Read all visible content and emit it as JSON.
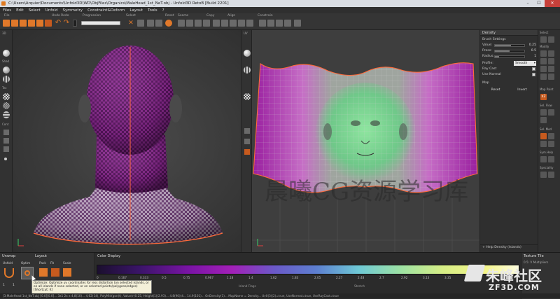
{
  "window": {
    "title": "C:\\Users\\Arquier\\Documents\\Unfold3D\\WD\\ObjFiles\\Organics\\MaleHead_1st_NeT.obj - Unfold3D RetoB [Build 2201]",
    "controls": [
      "–",
      "☐",
      "✕"
    ]
  },
  "menu": [
    "Files",
    "Edit",
    "Select",
    "Unfold",
    "Symmetry",
    "Constraint&Deform",
    "Layout",
    "Tools",
    "?"
  ],
  "toolbar": {
    "groups": [
      "File",
      "Undo Redo",
      "Progression",
      "Select",
      "Reset",
      "Seams",
      "Copy",
      "Align",
      "Constrain"
    ]
  },
  "left_strip": {
    "labels": [
      "3D",
      "Shad",
      "Tex",
      "Cont"
    ]
  },
  "uv_view": {
    "label": "UV"
  },
  "density_panel": {
    "header": "Density",
    "section": "Brush Settings",
    "rows": [
      {
        "label": "Value:",
        "value": "0.25",
        "fill": 0.55
      },
      {
        "label": "Press:",
        "value": "0.5",
        "fill": 0.5
      },
      {
        "label": "Radius:",
        "value": "1",
        "fill": 0.15
      }
    ],
    "profile_label": "Profile:",
    "profile_value": "Smooth",
    "ray_cast": "Ray Cast",
    "use_normal": "Use Normal",
    "map_label": "Map",
    "reset": "Reset",
    "invert": "Invert",
    "help": "Help Density (Islands)"
  },
  "right_strip": {
    "labels": [
      "Select",
      "Modify",
      "Map Paint",
      "Sel. Flow",
      "Sel. Mod",
      "Sym.Help",
      "Speciality"
    ]
  },
  "unwrap_panel": {
    "header_unwrap": "Unwrap",
    "header_layout": "Layout",
    "tabs": [
      "Unfold",
      "Optim",
      "Pack",
      "Fit",
      "Scale"
    ],
    "num_left": "1",
    "num_right": "1"
  },
  "color_display": {
    "header": "Color Display",
    "ticks": [
      "0",
      "0.167",
      "0.333",
      "0.5",
      "0.75",
      "0.967",
      "1.18",
      "1.4",
      "1.62",
      "1.83",
      "2.05",
      "2.27",
      "2.48",
      "2.7",
      "2.92",
      "3.13",
      "3.35",
      "3.57",
      "3.78",
      "4"
    ],
    "sublabels": [
      "Island Flags",
      "Stretch"
    ]
  },
  "texture_panel": {
    "header": "Texture Tile",
    "sub": "0.5: V Multipliers"
  },
  "tooltip": {
    "lines": [
      "Optimize: Optimize uv coordinates for less distortion (on selected islands, or",
      "on all islands if none selected, or on selected points/polygons/edges)",
      "[Shortcut: K]"
    ]
  },
  "status": "[3:MaleHead 1st_NeT.obj [0.0][0.0]... 3x1 2x x 4,8(10)... 4,62(14), PolyMid(gon(t), Value(r)0.25, Height(1)(2.93)... 4.8(90)(4... 14.9(101)... OnDensity(1)... MapName = Density... Uv0(3)(2)=true, UseNormal=true, UseRayCast=true",
  "watermarks": {
    "main": "晨曦CG资源学习库",
    "brand": "朱峰社区",
    "url": "ZF3D.COM"
  },
  "colors": {
    "accent": "#e0782a",
    "mesh_purple": "#8a1f8f",
    "seam": "#ff6a3a",
    "uv_green": "#7fd890"
  }
}
